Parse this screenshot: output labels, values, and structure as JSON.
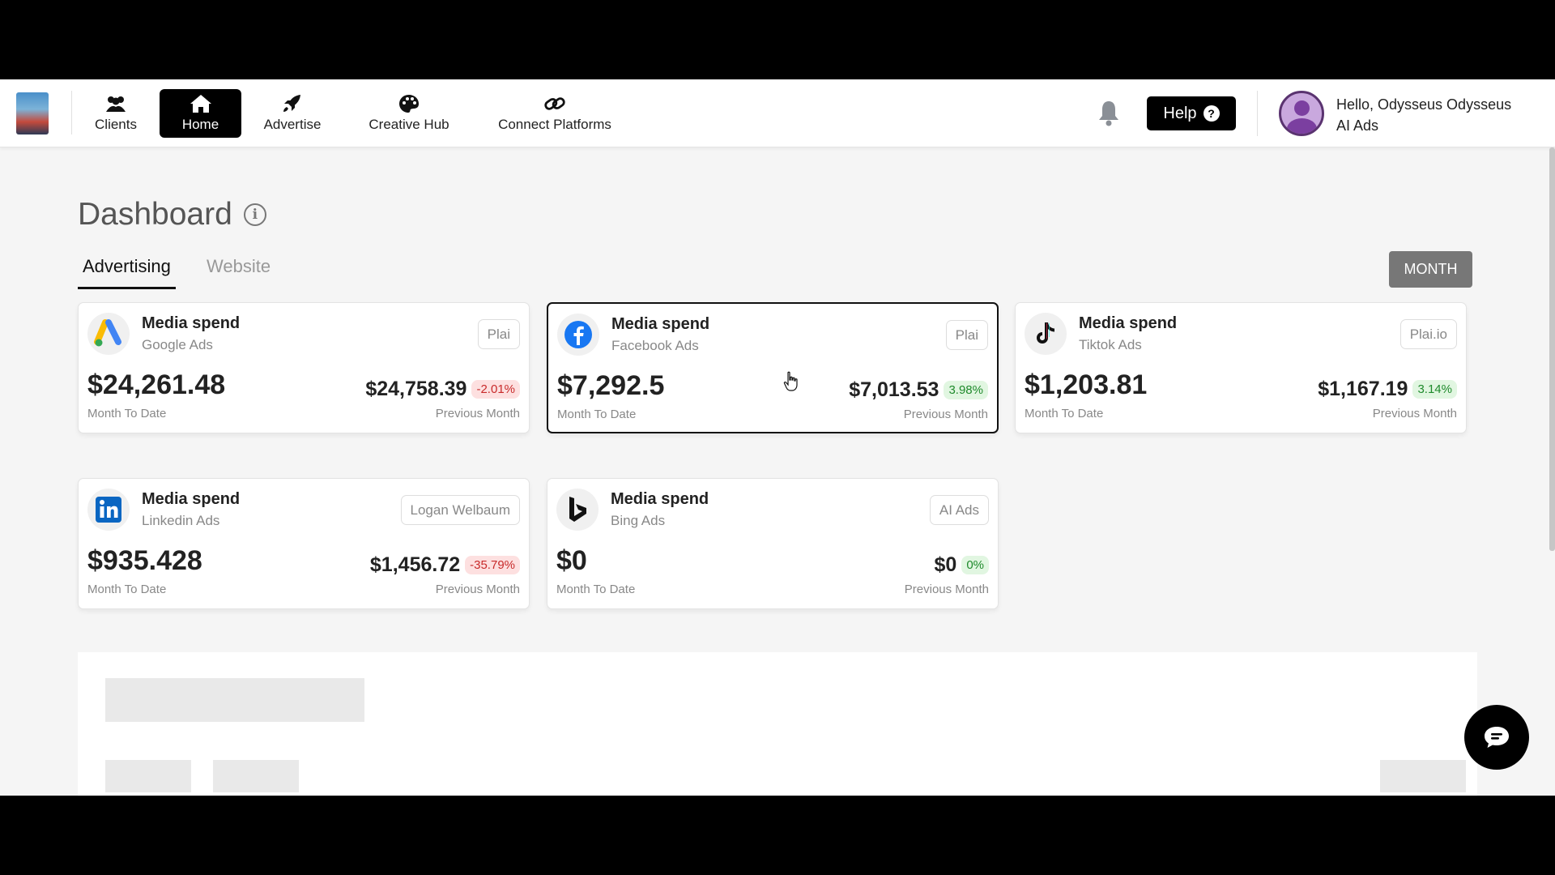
{
  "nav": {
    "items": [
      {
        "label": "Clients",
        "icon": "users-icon"
      },
      {
        "label": "Home",
        "icon": "home-icon",
        "active": true
      },
      {
        "label": "Advertise",
        "icon": "rocket-icon"
      },
      {
        "label": "Creative Hub",
        "icon": "palette-icon"
      },
      {
        "label": "Connect Platforms",
        "icon": "link-icon"
      }
    ],
    "help_label": "Help",
    "user": {
      "greeting": "Hello, Odysseus Odysseus",
      "org": "AI Ads"
    }
  },
  "dashboard": {
    "title": "Dashboard",
    "tabs": [
      {
        "label": "Advertising",
        "active": true
      },
      {
        "label": "Website",
        "active": false
      }
    ],
    "period_button": "MONTH"
  },
  "cards": [
    {
      "title": "Media spend",
      "platform": "Google Ads",
      "tag": "Plai",
      "value": "$24,261.48",
      "value_label": "Month To Date",
      "prev_value": "$24,758.39",
      "pct": "-2.01%",
      "pct_type": "neg",
      "prev_label": "Previous Month"
    },
    {
      "title": "Media spend",
      "platform": "Facebook Ads",
      "tag": "Plai",
      "value": "$7,292.5",
      "value_label": "Month To Date",
      "prev_value": "$7,013.53",
      "pct": "3.98%",
      "pct_type": "pos",
      "prev_label": "Previous Month",
      "selected": true
    },
    {
      "title": "Media spend",
      "platform": "Tiktok Ads",
      "tag": "Plai.io",
      "value": "$1,203.81",
      "value_label": "Month To Date",
      "prev_value": "$1,167.19",
      "pct": "3.14%",
      "pct_type": "pos",
      "prev_label": "Previous Month"
    },
    {
      "title": "Media spend",
      "platform": "Linkedin Ads",
      "tag": "Logan Welbaum",
      "value": "$935.428",
      "value_label": "Month To Date",
      "prev_value": "$1,456.72",
      "pct": "-35.79%",
      "pct_type": "neg",
      "prev_label": "Previous Month"
    },
    {
      "title": "Media spend",
      "platform": "Bing Ads",
      "tag": "AI Ads",
      "value": "$0",
      "value_label": "Month To Date",
      "prev_value": "$0",
      "pct": "0%",
      "pct_type": "pos",
      "prev_label": "Previous Month"
    }
  ],
  "colors": {
    "accent": "#000000",
    "negative": "#c82a2a",
    "positive": "#1f8a2c"
  }
}
